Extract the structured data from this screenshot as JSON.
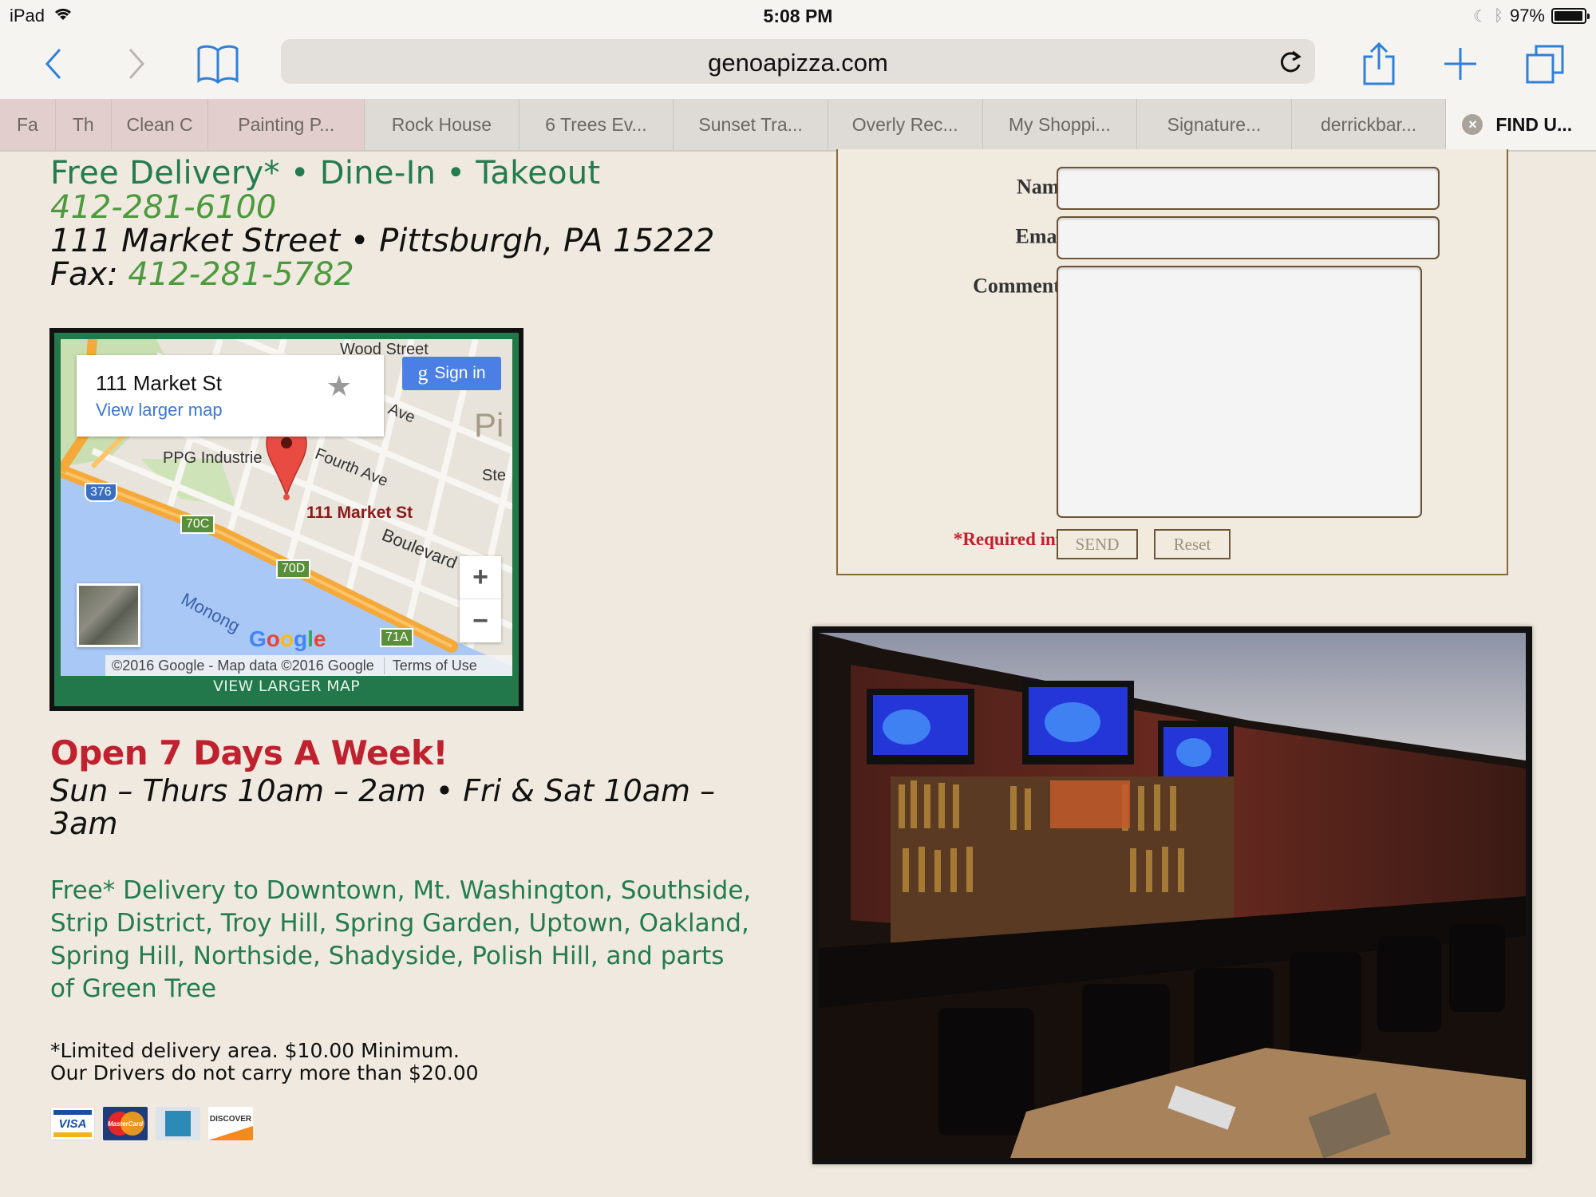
{
  "status_bar": {
    "device": "iPad",
    "time": "5:08 PM",
    "battery": "97%",
    "battery_level": 0.97
  },
  "toolbar": {
    "url": "genoapizza.com"
  },
  "tabs": [
    {
      "label": "Fa",
      "active": false
    },
    {
      "label": "Th",
      "active": false
    },
    {
      "label": "Clean C",
      "active": false
    },
    {
      "label": "Painting P...",
      "active": false
    },
    {
      "label": "Rock House",
      "active": false
    },
    {
      "label": "6 Trees Ev...",
      "active": false
    },
    {
      "label": "Sunset Tra...",
      "active": false
    },
    {
      "label": "Overly Rec...",
      "active": false
    },
    {
      "label": "My Shoppi...",
      "active": false
    },
    {
      "label": "Signature...",
      "active": false
    },
    {
      "label": "derrickbar...",
      "active": false
    },
    {
      "label": "FIND U...",
      "active": true
    }
  ],
  "info": {
    "tagline": "Free Delivery* • Dine-In • Takeout",
    "phone": "412-281-6100",
    "address": "111 Market Street • Pittsburgh, PA 15222",
    "fax_label": "Fax: ",
    "fax_number": "412-281-5782"
  },
  "map": {
    "place_title": "111 Market St",
    "view_larger_link": "View larger map",
    "sign_in": "Sign in",
    "pin_label": "111 Market St",
    "labels": {
      "wood_street": "Wood Street",
      "ppg": "PPG Industrie",
      "fourth_ave": "Fourth Ave",
      "ave": "Ave",
      "boulevard": "Boulevard",
      "monongahela": "Monong",
      "pi": "Pi",
      "ste": "Ste",
      "interstate": "376",
      "exit_70c": "70C",
      "exit_70d": "70D",
      "exit_71a": "71A"
    },
    "google": "Google",
    "copyright": "©2016 Google - Map data ©2016 Google",
    "terms": "Terms of Use",
    "zoom_in": "+",
    "zoom_out": "−",
    "view_larger_bar": "VIEW LARGER MAP"
  },
  "hours": {
    "heading": "Open 7 Days A Week!",
    "schedule": "Sun – Thurs 10am – 2am • Fri & Sat 10am – 3am"
  },
  "delivery": {
    "areas": "Free* Delivery to Downtown, Mt. Washington, Southside, Strip District, Troy Hill, Spring Garden, Uptown, Oakland, Spring Hill, Northside, Shadyside, Polish Hill, and parts of Green Tree",
    "note_line1": "*Limited delivery area. $10.00 Minimum.",
    "note_line2": "Our Drivers do not carry more than $20.00"
  },
  "payment_cards": [
    {
      "name": "VISA"
    },
    {
      "name": "MasterCard"
    },
    {
      "name": "American Express"
    },
    {
      "name": "DISCOVER"
    }
  ],
  "form": {
    "name_label": "Name",
    "email_label": "Email",
    "comments_label": "Comments",
    "required_mark": "*",
    "name_value": "",
    "email_value": "",
    "comments_value": "",
    "required_info": "*Required info",
    "send": "SEND",
    "reset": "Reset"
  },
  "colors": {
    "page_bg": "#f0e9df",
    "green": "#227c4f",
    "light_green": "#4c9a3d",
    "red": "#c0212e",
    "ios_blue": "#2f80d8",
    "form_border": "#8a6a3a"
  }
}
